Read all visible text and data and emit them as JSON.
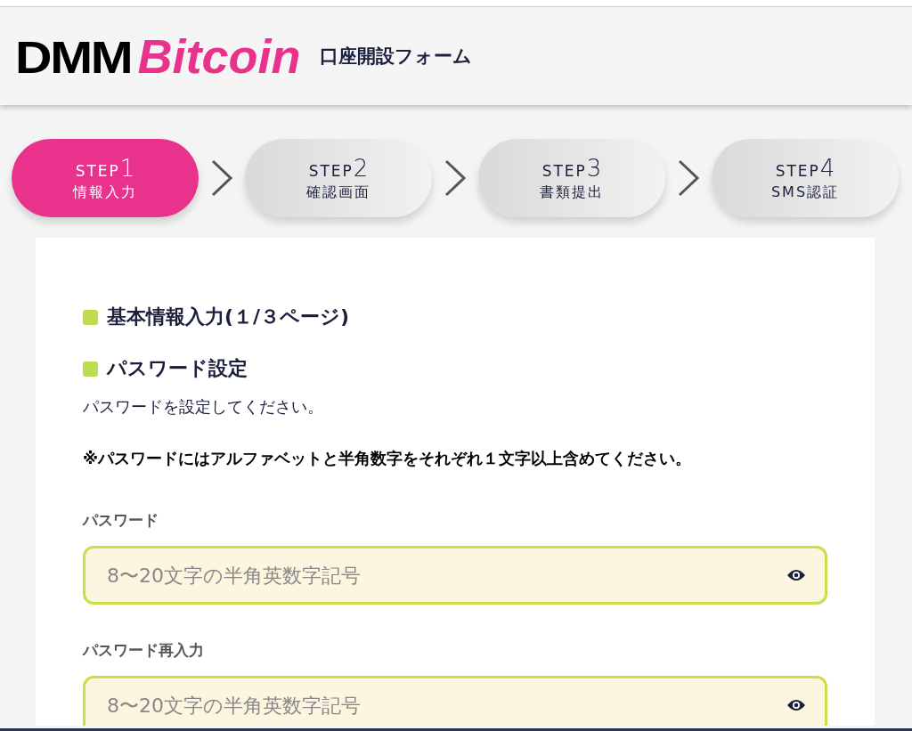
{
  "header": {
    "logo": {
      "part_1": "DMM",
      "part_2": "Bitcoin"
    },
    "title": "口座開設フォーム"
  },
  "steps": [
    {
      "label": "STEP",
      "number": "1",
      "name": "情報入力",
      "selected": true
    },
    {
      "label": "STEP",
      "number": "2",
      "name": "確認画面",
      "selected": false
    },
    {
      "label": "STEP",
      "number": "3",
      "name": "書類提出",
      "selected": false
    },
    {
      "label": "STEP",
      "number": "4",
      "name": "SMS認証",
      "selected": false
    }
  ],
  "form": {
    "headings": [
      "基本情報入力(１/３ページ)",
      "パスワード設定"
    ],
    "description": "パスワードを設定してください。",
    "note": "※パスワードにはアルファベットと半角数字をそれぞれ１文字以上含めてください。",
    "fields": [
      {
        "label": "パスワード",
        "placeholder": "8〜20文字の半角英数字記号"
      },
      {
        "label": "パスワード再入力",
        "placeholder": "8〜20文字の半角英数字記号"
      }
    ]
  }
}
